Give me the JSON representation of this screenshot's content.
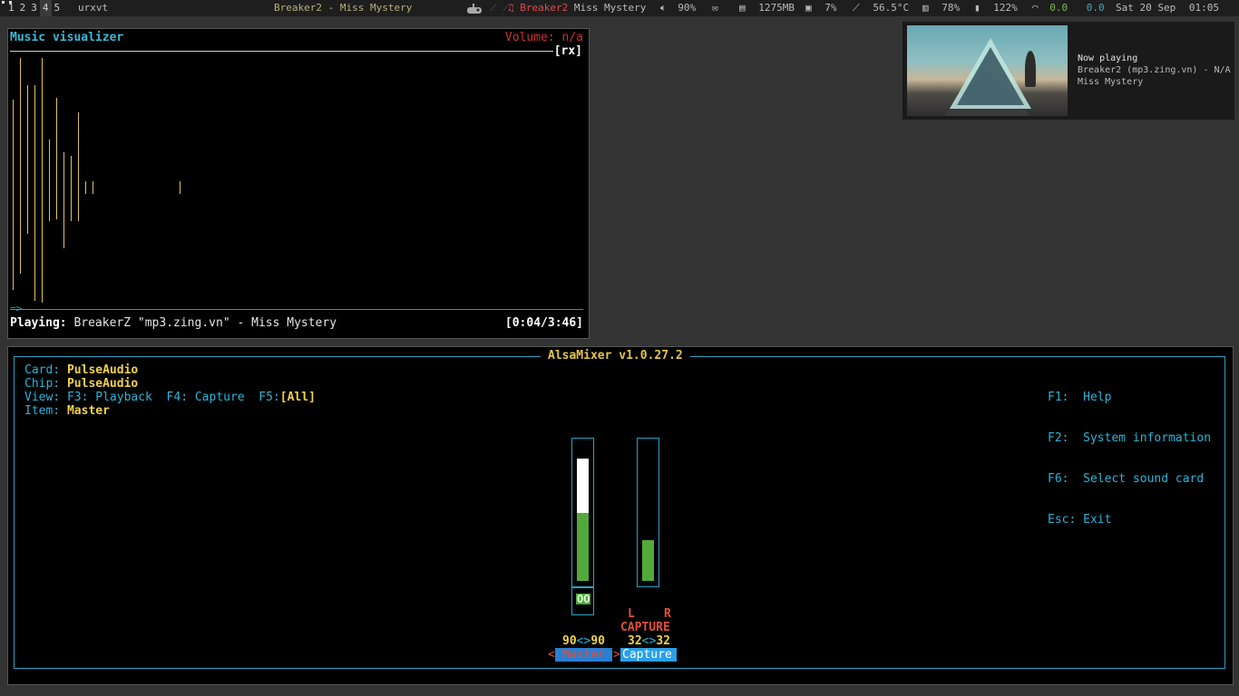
{
  "topbar": {
    "workspaces": [
      "1",
      "2",
      "3",
      "4",
      "5"
    ],
    "active_workspace": "4",
    "window_name": "urxvt",
    "window_title": "Breaker2 - Miss Mystery",
    "music_icon": "note-icon",
    "music_artist": "Breaker2",
    "music_title": "Miss Mystery",
    "volume": "90%",
    "mail": "",
    "memory": "1275MB",
    "cpu": "7%",
    "temperature": "56.5°C",
    "disk": "78%",
    "battery": "122%",
    "net_down": "0.0",
    "net_up": "0.0",
    "date": "Sat 20 Sep",
    "time": "01:05"
  },
  "visualizer": {
    "title": "Music visualizer",
    "volume": "Volume: n/a",
    "tag": "[rx]",
    "arrow": "=>",
    "playing_label": "Playing:",
    "playing_text": "BreakerZ \"mp3.zing.vn\" - Miss Mystery",
    "time": "[0:04/3:46]"
  },
  "notification": {
    "heading": "Now playing",
    "line1": "Breaker2 (mp3.zing.vn) - N/A",
    "line2": "Miss Mystery"
  },
  "alsamixer": {
    "title": "AlsaMixer v1.0.27.2",
    "card_label": "Card:",
    "card": "PulseAudio",
    "chip_label": "Chip:",
    "chip": "PulseAudio",
    "view_label": "View:",
    "view_f3": "F3: Playback",
    "view_f4": "F4: Capture",
    "view_f5": "F5:",
    "view_all": "[All]",
    "item_label": "Item:",
    "item": "Master",
    "keys": [
      {
        "key": "F1:",
        "action": "Help"
      },
      {
        "key": "F2:",
        "action": "System information"
      },
      {
        "key": "F6:",
        "action": "Select sound card"
      },
      {
        "key": "Esc:",
        "action": "Exit"
      }
    ],
    "master": {
      "name": "Master",
      "left": "90",
      "right": "90",
      "mute": "OO",
      "level": 0.9
    },
    "capture": {
      "name": "Capture",
      "left": "32",
      "right": "32",
      "level": 0.32,
      "lr_l": "L",
      "lr_r": "R",
      "label": "CAPTURE"
    },
    "arrows": "<>"
  }
}
